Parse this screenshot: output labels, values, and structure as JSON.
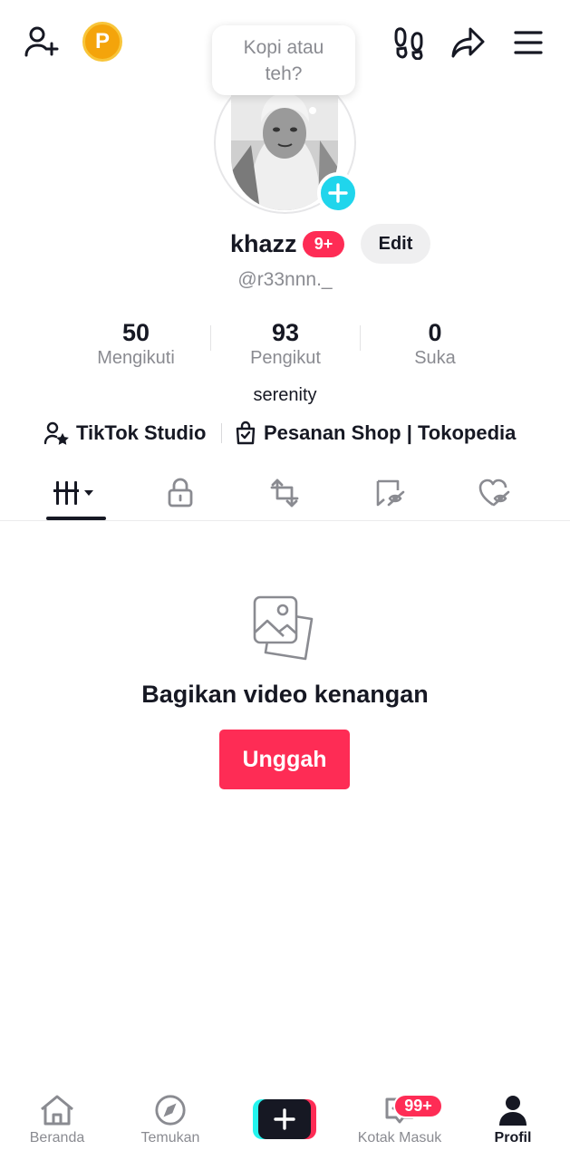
{
  "header": {
    "add_friend_icon": "person-plus-icon",
    "coin_label": "P",
    "footprints_icon": "footprints-icon",
    "share_icon": "share-icon",
    "menu_icon": "hamburger-menu-icon"
  },
  "avatar": {
    "bubble_text_line1": "Kopi atau",
    "bubble_text_line2": "teh?",
    "add_icon": "plus-icon"
  },
  "profile": {
    "display_name": "khazz",
    "badge": "9+",
    "edit_label": "Edit",
    "username": "@r33nnn._",
    "bio": "serenity"
  },
  "stats": [
    {
      "value": "50",
      "label": "Mengikuti"
    },
    {
      "value": "93",
      "label": "Pengikut"
    },
    {
      "value": "0",
      "label": "Suka"
    }
  ],
  "links": {
    "studio": "TikTok Studio",
    "shop": "Pesanan Shop | Tokopedia"
  },
  "tabs": [
    {
      "name": "videos",
      "icon": "grid-bars-icon"
    },
    {
      "name": "private",
      "icon": "lock-icon"
    },
    {
      "name": "reposts",
      "icon": "repost-icon"
    },
    {
      "name": "favorites",
      "icon": "bookmark-hidden-icon"
    },
    {
      "name": "liked",
      "icon": "heart-hidden-icon"
    }
  ],
  "empty_state": {
    "icon": "photo-stack-icon",
    "title": "Bagikan video kenangan",
    "button": "Unggah"
  },
  "bottom_nav": {
    "home": "Beranda",
    "discover": "Temukan",
    "inbox": "Kotak Masuk",
    "inbox_badge": "99+",
    "profile": "Profil"
  },
  "colors": {
    "accent": "#fe2c55",
    "cyan": "#20d5ec",
    "text": "#161823",
    "muted": "#8a8b91"
  }
}
